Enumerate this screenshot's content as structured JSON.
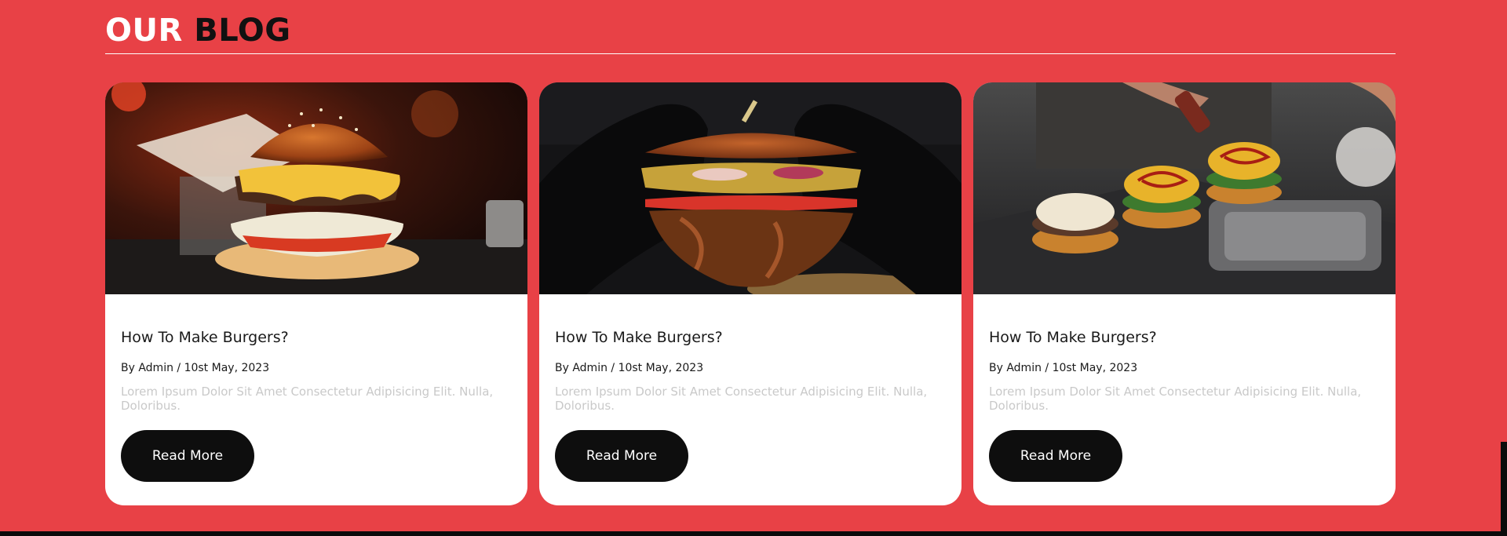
{
  "blog": {
    "heading_white": "OUR",
    "heading_dark": "BLOG",
    "posts": [
      {
        "image": "burger-cheese-photo",
        "title": "How To Make Burgers?",
        "meta": "By Admin / 10st May, 2023",
        "excerpt": "Lorem Ipsum Dolor Sit Amet Consectetur Adipisicing Elit. Nulla, Doloribus.",
        "button_label": "Read More"
      },
      {
        "image": "burger-gloves-photo",
        "title": "How To Make Burgers?",
        "meta": "By Admin / 10st May, 2023",
        "excerpt": "Lorem Ipsum Dolor Sit Amet Consectetur Adipisicing Elit. Nulla, Doloribus.",
        "button_label": "Read More"
      },
      {
        "image": "burger-sliders-photo",
        "title": "How To Make Burgers?",
        "meta": "By Admin / 10st May, 2023",
        "excerpt": "Lorem Ipsum Dolor Sit Amet Consectetur Adipisicing Elit. Nulla, Doloribus.",
        "button_label": "Read More"
      }
    ]
  },
  "colors": {
    "background": "#e84146",
    "card": "#ffffff",
    "button": "#0e0e0e",
    "excerpt": "#c9c9c9"
  }
}
